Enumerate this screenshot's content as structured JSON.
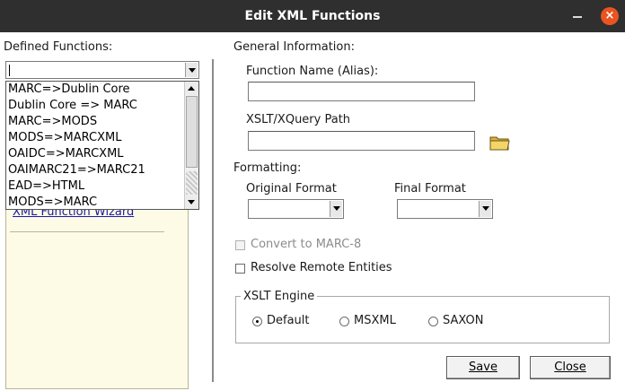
{
  "window": {
    "title": "Edit XML Functions"
  },
  "left": {
    "defined_functions_label": "Defined Functions:",
    "selected_value": "",
    "dropdown_items": [
      "MARC=>Dublin Core",
      "Dublin Core => MARC",
      "MARC=>MODS",
      "MODS=>MARCXML",
      "OAIDC=>MARCXML",
      "OAIMARC21=>MARC21",
      "EAD=>HTML",
      "MODS=>MARC"
    ],
    "wizard_link": "XML Function Wizard"
  },
  "general": {
    "header": "General Information:",
    "function_name_label": "Function Name (Alias):",
    "function_name_value": "",
    "xslt_path_label": "XSLT/XQuery Path",
    "xslt_path_value": ""
  },
  "formatting": {
    "header": "Formatting:",
    "original_format_label": "Original Format",
    "original_format_value": "",
    "final_format_label": "Final Format",
    "final_format_value": ""
  },
  "options": {
    "convert_marc8_label": "Convert to MARC-8",
    "convert_marc8_checked": false,
    "convert_marc8_enabled": false,
    "resolve_entities_label": "Resolve Remote Entities",
    "resolve_entities_checked": false
  },
  "engine": {
    "title": "XSLT Engine",
    "options": [
      "Default",
      "MSXML",
      "SAXON"
    ],
    "selected": "Default"
  },
  "buttons": {
    "save": "Save",
    "close": "Close"
  },
  "colors": {
    "titlebar": "#2f2f2f",
    "close_button": "#e95420",
    "panel": "#fdfbe6",
    "link": "#1a1aa6"
  }
}
